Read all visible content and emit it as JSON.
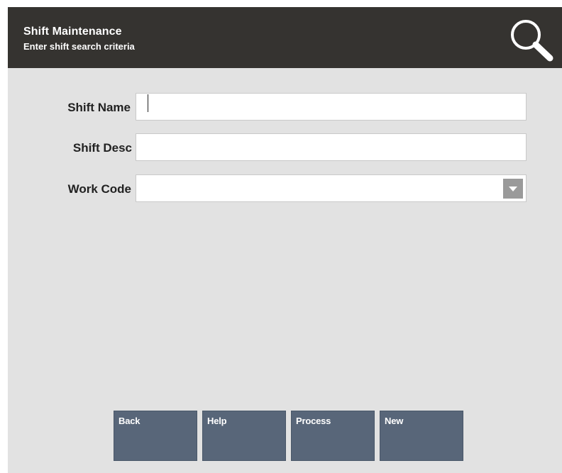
{
  "header": {
    "title": "Shift Maintenance",
    "subtitle": "Enter shift search criteria",
    "search_icon": "magnifying-glass-icon"
  },
  "form": {
    "shift_name": {
      "label": "Shift Name",
      "value": ""
    },
    "shift_desc": {
      "label": "Shift Desc",
      "value": ""
    },
    "work_code": {
      "label": "Work Code",
      "value": "",
      "dropdown_icon": "chevron-down-icon"
    }
  },
  "buttons": {
    "back": "Back",
    "help": "Help",
    "process": "Process",
    "new": "New"
  },
  "colors": {
    "header_bg": "#353330",
    "body_bg": "#e2e2e2",
    "button_bg": "#586679"
  }
}
